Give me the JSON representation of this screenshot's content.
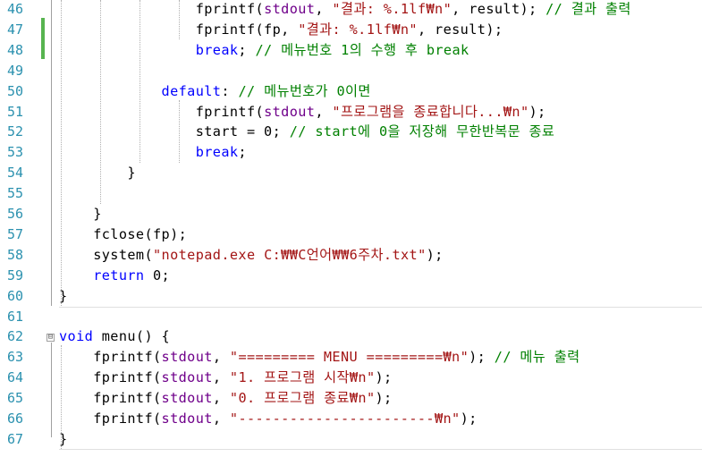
{
  "editor": {
    "lines": [
      {
        "num": "46",
        "indent": "                ",
        "tokens": [
          {
            "t": "fprintf(",
            "c": "fn"
          },
          {
            "t": "stdout",
            "c": "mac"
          },
          {
            "t": ", ",
            "c": "fn"
          },
          {
            "t": "\"결과: %.1lf₩n\"",
            "c": "str"
          },
          {
            "t": ", result); ",
            "c": "fn"
          },
          {
            "t": "// 결과 출력",
            "c": "cm"
          }
        ]
      },
      {
        "num": "47",
        "indent": "                ",
        "tokens": [
          {
            "t": "fprintf(fp, ",
            "c": "fn"
          },
          {
            "t": "\"결과: %.1lf₩n\"",
            "c": "str"
          },
          {
            "t": ", result);",
            "c": "fn"
          }
        ]
      },
      {
        "num": "48",
        "indent": "                ",
        "tokens": [
          {
            "t": "break",
            "c": "kw"
          },
          {
            "t": "; ",
            "c": "fn"
          },
          {
            "t": "// 메뉴번호 1의 수행 후 break",
            "c": "cm"
          }
        ]
      },
      {
        "num": "49",
        "indent": "",
        "tokens": []
      },
      {
        "num": "50",
        "indent": "            ",
        "tokens": [
          {
            "t": "default",
            "c": "kw"
          },
          {
            "t": ": ",
            "c": "fn"
          },
          {
            "t": "// 메뉴번호가 0이면",
            "c": "cm"
          }
        ]
      },
      {
        "num": "51",
        "indent": "                ",
        "tokens": [
          {
            "t": "fprintf(",
            "c": "fn"
          },
          {
            "t": "stdout",
            "c": "mac"
          },
          {
            "t": ", ",
            "c": "fn"
          },
          {
            "t": "\"프로그램을 종료합니다...₩n\"",
            "c": "str"
          },
          {
            "t": ");",
            "c": "fn"
          }
        ]
      },
      {
        "num": "52",
        "indent": "                ",
        "tokens": [
          {
            "t": "start = 0; ",
            "c": "fn"
          },
          {
            "t": "// start에 0을 저장해 무한반복문 종료",
            "c": "cm"
          }
        ]
      },
      {
        "num": "53",
        "indent": "                ",
        "tokens": [
          {
            "t": "break",
            "c": "kw"
          },
          {
            "t": ";",
            "c": "fn"
          }
        ]
      },
      {
        "num": "54",
        "indent": "        ",
        "tokens": [
          {
            "t": "}",
            "c": "fn"
          }
        ]
      },
      {
        "num": "55",
        "indent": "",
        "tokens": []
      },
      {
        "num": "56",
        "indent": "    ",
        "tokens": [
          {
            "t": "}",
            "c": "fn"
          }
        ]
      },
      {
        "num": "57",
        "indent": "    ",
        "tokens": [
          {
            "t": "fclose(fp);",
            "c": "fn"
          }
        ]
      },
      {
        "num": "58",
        "indent": "    ",
        "tokens": [
          {
            "t": "system(",
            "c": "fn"
          },
          {
            "t": "\"notepad.exe C:₩₩C언어₩₩6주차.txt\"",
            "c": "str"
          },
          {
            "t": ");",
            "c": "fn"
          }
        ]
      },
      {
        "num": "59",
        "indent": "    ",
        "tokens": [
          {
            "t": "return",
            "c": "kw"
          },
          {
            "t": " 0;",
            "c": "fn"
          }
        ]
      },
      {
        "num": "60",
        "indent": "",
        "tokens": [
          {
            "t": "}",
            "c": "fn"
          }
        ]
      },
      {
        "num": "61",
        "indent": "",
        "tokens": []
      },
      {
        "num": "62",
        "indent": "",
        "tokens": [
          {
            "t": "void",
            "c": "kw"
          },
          {
            "t": " menu() {",
            "c": "fn"
          }
        ]
      },
      {
        "num": "63",
        "indent": "    ",
        "tokens": [
          {
            "t": "fprintf(",
            "c": "fn"
          },
          {
            "t": "stdout",
            "c": "mac"
          },
          {
            "t": ", ",
            "c": "fn"
          },
          {
            "t": "\"========= MENU =========₩n\"",
            "c": "str"
          },
          {
            "t": "); ",
            "c": "fn"
          },
          {
            "t": "// 메뉴 출력",
            "c": "cm"
          }
        ]
      },
      {
        "num": "64",
        "indent": "    ",
        "tokens": [
          {
            "t": "fprintf(",
            "c": "fn"
          },
          {
            "t": "stdout",
            "c": "mac"
          },
          {
            "t": ", ",
            "c": "fn"
          },
          {
            "t": "\"1. 프로그램 시작₩n\"",
            "c": "str"
          },
          {
            "t": ");",
            "c": "fn"
          }
        ]
      },
      {
        "num": "65",
        "indent": "    ",
        "tokens": [
          {
            "t": "fprintf(",
            "c": "fn"
          },
          {
            "t": "stdout",
            "c": "mac"
          },
          {
            "t": ", ",
            "c": "fn"
          },
          {
            "t": "\"0. 프로그램 종료₩n\"",
            "c": "str"
          },
          {
            "t": ");",
            "c": "fn"
          }
        ]
      },
      {
        "num": "66",
        "indent": "    ",
        "tokens": [
          {
            "t": "fprintf(",
            "c": "fn"
          },
          {
            "t": "stdout",
            "c": "mac"
          },
          {
            "t": ", ",
            "c": "fn"
          },
          {
            "t": "\"-----------------------₩n\"",
            "c": "str"
          },
          {
            "t": ");",
            "c": "fn"
          }
        ]
      },
      {
        "num": "67",
        "indent": "",
        "tokens": [
          {
            "t": "}",
            "c": "fn"
          }
        ]
      }
    ],
    "colors": {
      "keyword": "#0000ff",
      "string": "#a31515",
      "comment": "#008000",
      "macro": "#6f008a",
      "line_number": "#2b91af",
      "change_bar": "#57b44f"
    },
    "fold_marker": "⊟"
  }
}
